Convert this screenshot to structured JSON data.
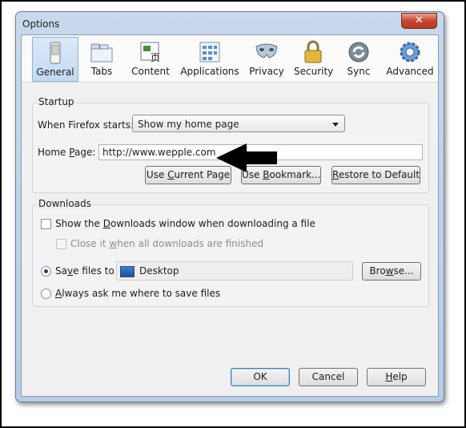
{
  "window": {
    "title": "Options",
    "close_glyph": "✕"
  },
  "toolbar": {
    "panes": [
      {
        "label": "General",
        "icon": "general-switch-icon",
        "selected": true
      },
      {
        "label": "Tabs",
        "icon": "tabs-icon",
        "selected": false
      },
      {
        "label": "Content",
        "icon": "content-icon",
        "selected": false
      },
      {
        "label": "Applications",
        "icon": "applications-icon",
        "selected": false
      },
      {
        "label": "Privacy",
        "icon": "privacy-mask-icon",
        "selected": false
      },
      {
        "label": "Security",
        "icon": "security-lock-icon",
        "selected": false
      },
      {
        "label": "Sync",
        "icon": "sync-icon",
        "selected": false
      },
      {
        "label": "Advanced",
        "icon": "advanced-gear-icon",
        "selected": false
      }
    ]
  },
  "startup": {
    "group_label": "Startup",
    "when_starts_label": "When Firefox starts:",
    "when_starts_value": "Show my home page",
    "home_page_label_pre": "Home ",
    "home_page_label_key": "P",
    "home_page_label_post": "age:",
    "home_page_value": "http://www.wepple.com",
    "use_current_pre": "Use ",
    "use_current_key": "C",
    "use_current_post": "urrent Page",
    "use_bookmark_pre": "Use ",
    "use_bookmark_key": "B",
    "use_bookmark_post": "ookmark...",
    "restore_key": "R",
    "restore_post": "estore to Default"
  },
  "downloads": {
    "group_label": "Downloads",
    "show_window_pre": "Show the ",
    "show_window_key": "D",
    "show_window_post": "ownloads window when downloading a file",
    "close_when_pre": "Close it ",
    "close_when_key": "w",
    "close_when_post": "hen all downloads are finished",
    "save_files_pre": "Sa",
    "save_files_key": "v",
    "save_files_post": "e files to",
    "save_folder": "Desktop",
    "browse_pre": "Bro",
    "browse_key": "w",
    "browse_post": "se...",
    "always_ask_pre": "",
    "always_ask_key": "A",
    "always_ask_post": "lways ask me where to save files"
  },
  "footer": {
    "ok": "OK",
    "cancel": "Cancel",
    "help_key": "H",
    "help_post": "elp"
  },
  "colors": {
    "selected_pane": "#c3d9f2",
    "arrow": "#000000"
  }
}
